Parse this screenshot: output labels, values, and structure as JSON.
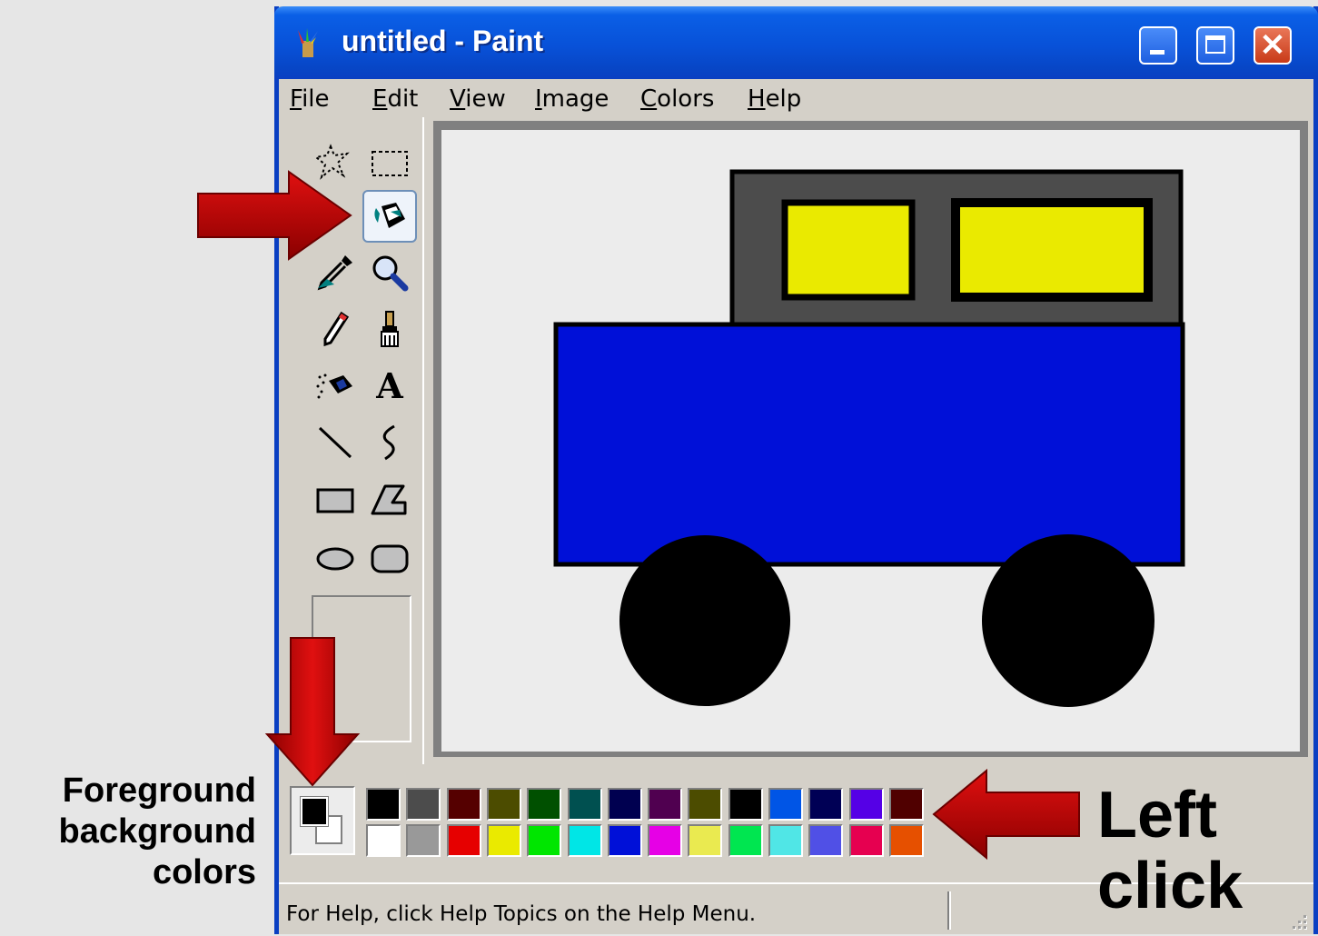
{
  "window": {
    "title": "untitled - Paint",
    "active_titlebar_color": "#0a5fe6"
  },
  "menu": {
    "items": [
      {
        "label": "File",
        "mnemonic": "F"
      },
      {
        "label": "Edit",
        "mnemonic": "E"
      },
      {
        "label": "View",
        "mnemonic": "V"
      },
      {
        "label": "Image",
        "mnemonic": "I"
      },
      {
        "label": "Colors",
        "mnemonic": "C"
      },
      {
        "label": "Help",
        "mnemonic": "H"
      }
    ]
  },
  "toolbox": {
    "tools": [
      {
        "name": "free-form-select",
        "icon": "free-select-icon"
      },
      {
        "name": "select",
        "icon": "rect-select-icon"
      },
      {
        "name": "eraser",
        "icon": "eraser-icon"
      },
      {
        "name": "fill-with-color",
        "icon": "paint-bucket-icon",
        "selected": true
      },
      {
        "name": "pick-color",
        "icon": "eyedropper-icon"
      },
      {
        "name": "magnifier",
        "icon": "magnifier-icon"
      },
      {
        "name": "pencil",
        "icon": "pencil-icon"
      },
      {
        "name": "brush",
        "icon": "brush-icon"
      },
      {
        "name": "airbrush",
        "icon": "airbrush-icon"
      },
      {
        "name": "text",
        "icon": "text-icon",
        "glyph": "A"
      },
      {
        "name": "line",
        "icon": "line-icon"
      },
      {
        "name": "curve",
        "icon": "curve-icon"
      },
      {
        "name": "rectangle",
        "icon": "rectangle-icon"
      },
      {
        "name": "polygon",
        "icon": "polygon-icon"
      },
      {
        "name": "ellipse",
        "icon": "ellipse-icon"
      },
      {
        "name": "rounded-rectangle",
        "icon": "rounded-rect-icon"
      }
    ]
  },
  "drawing": {
    "body_color": "#0010d8",
    "cab_color": "#4c4c4c",
    "window_color": "#eaea00",
    "wheel_color": "#000000"
  },
  "palette": {
    "foreground": "#000000",
    "background": "#ffffff",
    "top_row": [
      "#000000",
      "#4c4c4c",
      "#550000",
      "#4c4c00",
      "#005000",
      "#005050",
      "#000050",
      "#500050",
      "#4c4c00",
      "#000000",
      "#0055e6",
      "#000055",
      "#5500e6",
      "#500000"
    ],
    "bottom_row": [
      "#ffffff",
      "#999999",
      "#e60000",
      "#eaea00",
      "#00e600",
      "#00e6e6",
      "#0010d8",
      "#e600e6",
      "#eaea50",
      "#00e650",
      "#50e6e6",
      "#5050e6",
      "#e60050",
      "#e65000"
    ]
  },
  "status": {
    "text": "For Help, click Help Topics on the Help Menu."
  },
  "annotations": {
    "left_click": "Left click",
    "fg_bg_colors": "Foreground background colors",
    "arrow_color": "#c80000"
  }
}
